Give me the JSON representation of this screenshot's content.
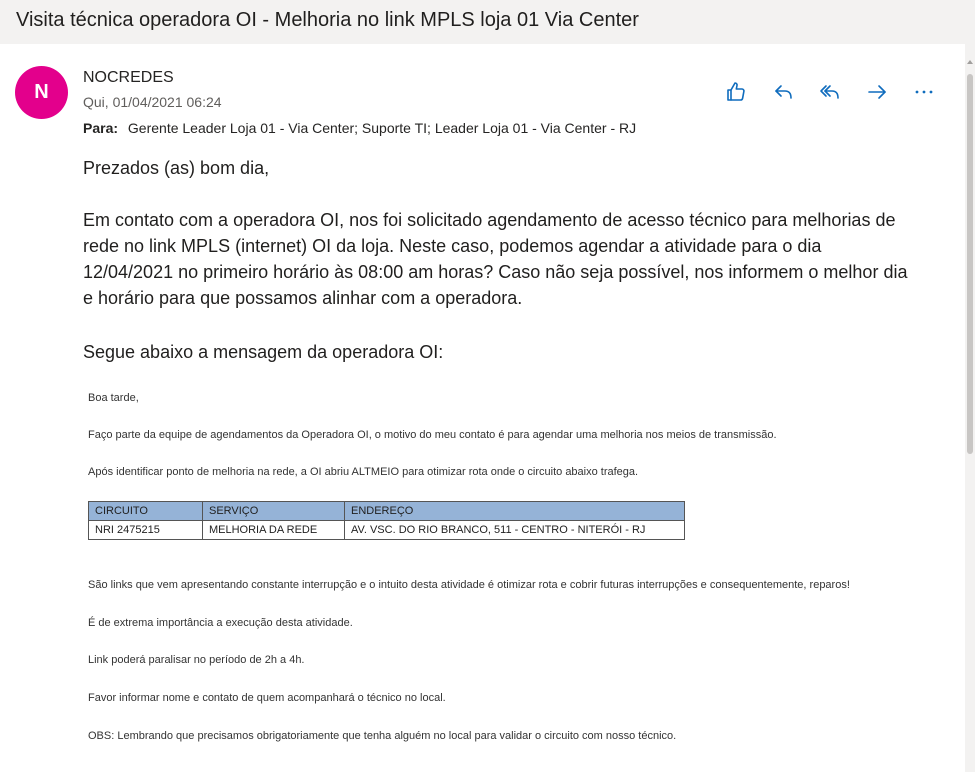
{
  "subject": "Visita técnica operadora OI - Melhoria no link MPLS loja 01 Via Center",
  "sender": {
    "initial": "N",
    "avatar_color": "#e3008c",
    "name": "NOCREDES",
    "date": "Qui, 01/04/2021 06:24"
  },
  "recipients": {
    "label": "Para:",
    "value": "Gerente Leader Loja 01 - Via Center; Suporte TI; Leader Loja 01 - Via Center - RJ"
  },
  "actions": [
    {
      "name": "like-icon"
    },
    {
      "name": "reply-icon"
    },
    {
      "name": "reply-all-icon"
    },
    {
      "name": "forward-icon"
    },
    {
      "name": "more-options-icon"
    }
  ],
  "message": {
    "greeting": "Prezados (as) bom dia,",
    "paragraph": "Em contato com a operadora OI, nos foi solicitado agendamento de acesso técnico para melhorias de rede no link MPLS (internet) OI da loja. Neste caso, podemos agendar a atividade para o dia 12/04/2021 no primeiro horário às 08:00 am horas? Caso não seja possível, nos informem o melhor dia e horário para que possamos alinhar com a operadora.",
    "intro": "Segue abaixo a mensagem da operadora OI:"
  },
  "embedded": {
    "line1": "Boa tarde,",
    "line2": "Faço parte da equipe de agendamentos  da Operadora OI, o motivo do meu contato é para agendar uma melhoria nos meios de transmissão.",
    "line3": "Após identificar ponto de melhoria na rede, a OI abriu ALTMEIO para otimizar rota onde o circuito abaixo trafega.",
    "table": {
      "header_color": "#95b3d7",
      "headers": [
        "CIRCUITO",
        "SERVIÇO",
        "ENDEREÇO"
      ],
      "row": [
        "NRI 2475215",
        "MELHORIA DA REDE",
        "AV. VSC. DO RIO BRANCO, 511 - CENTRO - NITERÓI - RJ"
      ]
    },
    "line4": "São links que vem apresentando constante interrupção e o intuito desta atividade é otimizar rota e cobrir futuras interrupções e consequentemente, reparos!",
    "line5": "É de extrema importância a execução desta atividade.",
    "line6": "Link poderá paralisar no período de 2h  a 4h.",
    "line7": "Favor informar nome e contato de quem acompanhará o técnico no local.",
    "line8": "OBS: Lembrando que precisamos obrigatoriamente que tenha alguém no local para validar o circuito com nosso técnico."
  }
}
